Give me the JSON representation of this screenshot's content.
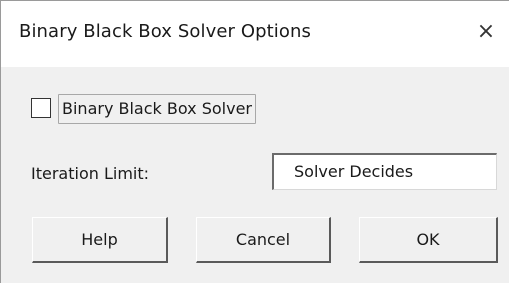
{
  "window": {
    "title": "Binary Black Box Solver Options",
    "close_glyph": "×"
  },
  "options": {
    "checkbox_label": "Binary Black Box Solver",
    "checkbox_checked": false,
    "iteration_limit_label": "Iteration Limit:",
    "iteration_limit_value": "Solver Decides"
  },
  "buttons": {
    "help_label": "Help",
    "cancel_label": "Cancel",
    "ok_label": "OK"
  },
  "icons": {
    "close": "close-icon"
  }
}
